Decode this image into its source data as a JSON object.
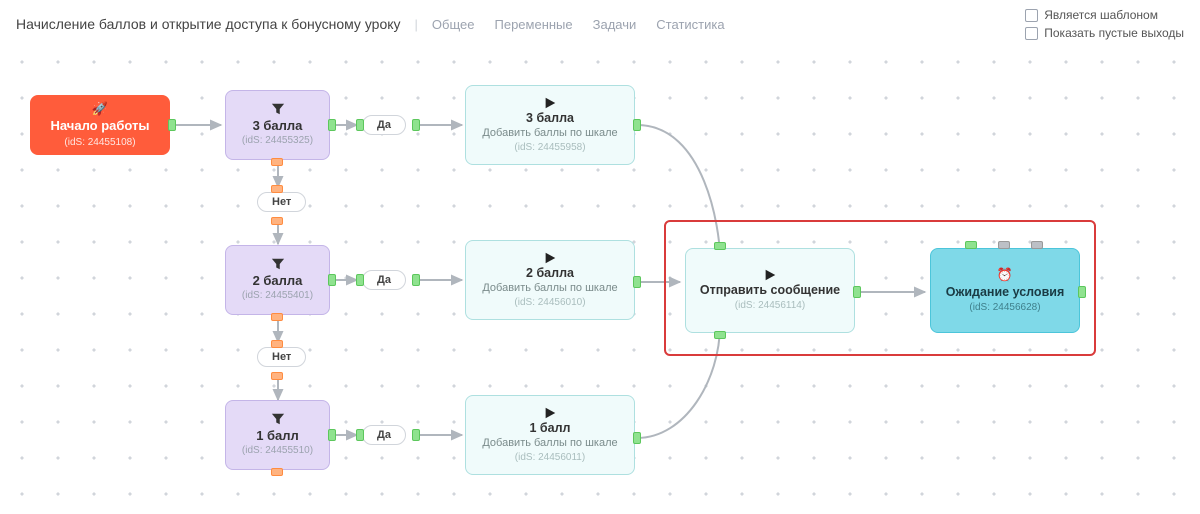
{
  "header": {
    "title": "Начисление баллов и открытие доступа к бонусному уроку",
    "tabs": [
      "Общее",
      "Переменные",
      "Задачи",
      "Статистика"
    ],
    "checkboxes": {
      "template": "Является шаблоном",
      "show_empty": "Показать пустые выходы"
    }
  },
  "labels": {
    "yes": "Да",
    "no": "Нет",
    "add_points": "Добавить баллы по шкале"
  },
  "nodes": {
    "start": {
      "title": "Начало работы",
      "id": "(idS: 24455108)"
    },
    "filter3": {
      "title": "3 балла",
      "id": "(idS: 24455325)"
    },
    "filter2": {
      "title": "2 балла",
      "id": "(idS: 24455401)"
    },
    "filter1": {
      "title": "1 балл",
      "id": "(idS: 24455510)"
    },
    "action3": {
      "title": "3 балла",
      "id": "(idS: 24455958)"
    },
    "action2": {
      "title": "2 балла",
      "id": "(idS: 24456010)"
    },
    "action1": {
      "title": "1 балл",
      "id": "(idS: 24456011)"
    },
    "send": {
      "title": "Отправить сообщение",
      "id": "(idS: 24456114)"
    },
    "wait": {
      "title": "Ожидание условия",
      "id": "(idS: 24456628)"
    }
  }
}
